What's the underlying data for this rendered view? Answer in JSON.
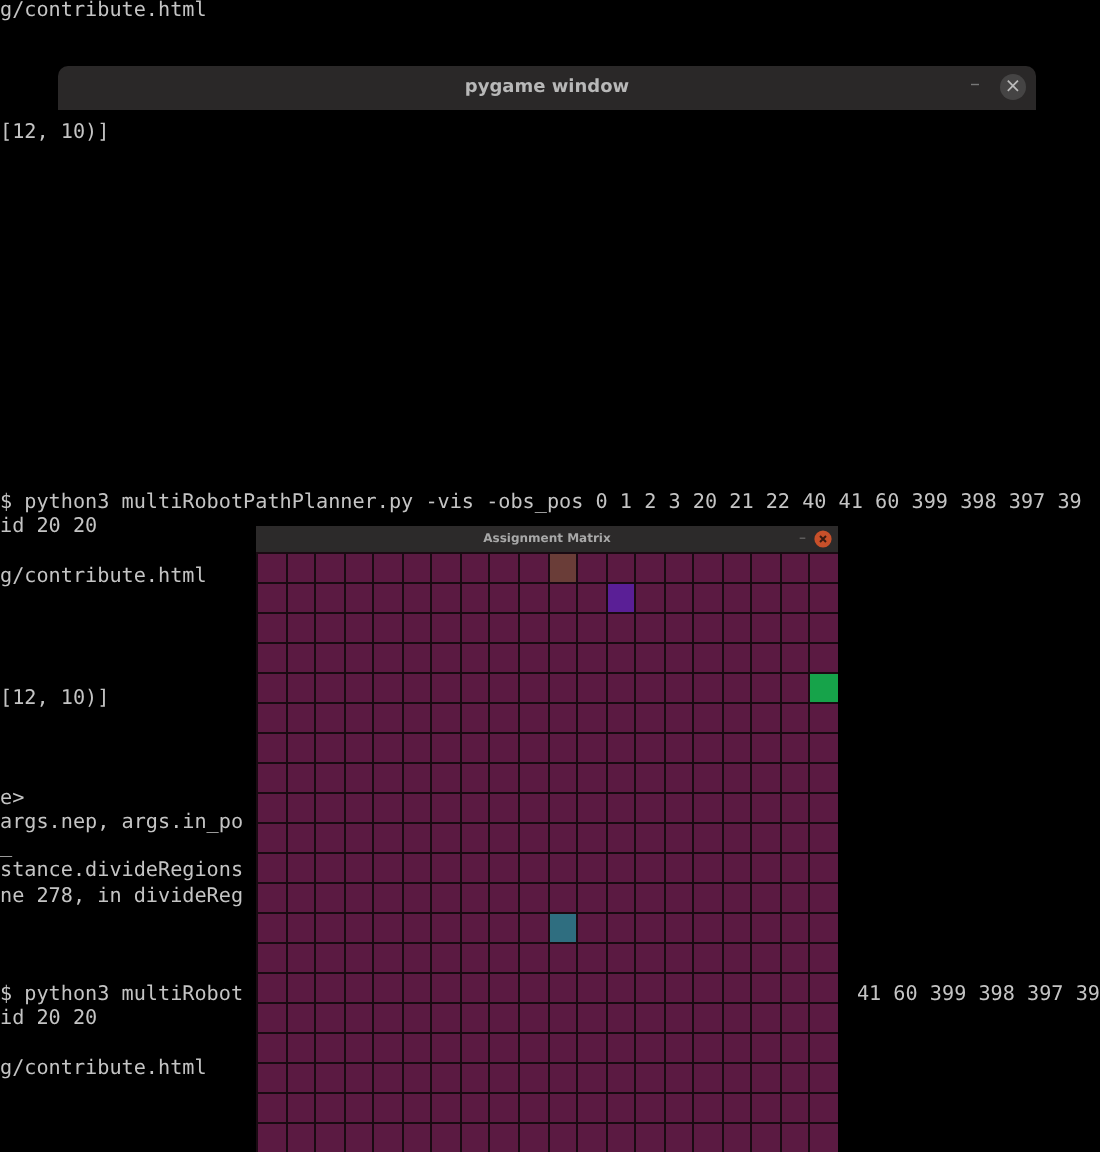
{
  "terminal": {
    "blocks": [
      [
        {
          "text": "g/contribute.html"
        }
      ],
      [
        {
          "text": "[12, 10)]"
        }
      ],
      [
        {
          "text": "$ python3 multiRobotPathPlanner.py -vis -obs_pos 0 1 2 3 20 21 22 40 41 60 399 398 397 39"
        },
        {
          "text": "id 20 20"
        }
      ],
      [
        {
          "text": "g/contribute.html"
        }
      ],
      [
        {
          "text": "[12, 10)]"
        }
      ],
      [
        {
          "text": "e>"
        },
        {
          "text": "args.nep, args.in_po"
        },
        {
          "text": "_"
        },
        {
          "text": "stance.divideRegions"
        },
        {
          "text": "ne 278, in divideReg"
        }
      ],
      [
        {
          "text": "$ python3 multiRobot",
          "right_text": "41 60 399 398 397 39"
        },
        {
          "text": "id 20 20"
        }
      ],
      [
        {
          "text": "g/contribute.html"
        }
      ]
    ]
  },
  "pygame_window": {
    "title": "pygame window",
    "minimize": "–",
    "close": "×"
  },
  "matrix_window": {
    "title": "Assignment Matrix",
    "minimize": "–",
    "grid_rows": [
      [
        {
          "color": "#5b1a42"
        },
        {
          "color": "#5b1a42"
        },
        {
          "color": "#5b1a42"
        },
        {
          "color": "#5b1a42"
        },
        {
          "color": "#5b1a42"
        },
        {
          "color": "#5b1a42"
        },
        {
          "color": "#5b1a42"
        },
        {
          "color": "#5b1a42"
        },
        {
          "color": "#5b1a42"
        },
        {
          "color": "#5b1a42"
        },
        {
          "color": "#6a3d38"
        },
        {
          "color": "#5b1a42"
        },
        {
          "color": "#5b1a42"
        },
        {
          "color": "#5b1a42"
        },
        {
          "color": "#5b1a42"
        },
        {
          "color": "#5b1a42"
        },
        {
          "color": "#5b1a42"
        },
        {
          "color": "#5b1a42"
        },
        {
          "color": "#5b1a42"
        },
        {
          "color": "#5b1a42"
        }
      ],
      [
        {
          "color": "#5b1a42"
        },
        {
          "color": "#5b1a42"
        },
        {
          "color": "#5b1a42"
        },
        {
          "color": "#5b1a42"
        },
        {
          "color": "#5b1a42"
        },
        {
          "color": "#5b1a42"
        },
        {
          "color": "#5b1a42"
        },
        {
          "color": "#5b1a42"
        },
        {
          "color": "#5b1a42"
        },
        {
          "color": "#5b1a42"
        },
        {
          "color": "#5b1a42"
        },
        {
          "color": "#5b1a42"
        },
        {
          "color": "#5a1f96"
        },
        {
          "color": "#5b1a42"
        },
        {
          "color": "#5b1a42"
        },
        {
          "color": "#5b1a42"
        },
        {
          "color": "#5b1a42"
        },
        {
          "color": "#5b1a42"
        },
        {
          "color": "#5b1a42"
        },
        {
          "color": "#5b1a42"
        }
      ],
      [
        {
          "color": "#5b1a42"
        },
        {
          "color": "#5b1a42"
        },
        {
          "color": "#5b1a42"
        },
        {
          "color": "#5b1a42"
        },
        {
          "color": "#5b1a42"
        },
        {
          "color": "#5b1a42"
        },
        {
          "color": "#5b1a42"
        },
        {
          "color": "#5b1a42"
        },
        {
          "color": "#5b1a42"
        },
        {
          "color": "#5b1a42"
        },
        {
          "color": "#5b1a42"
        },
        {
          "color": "#5b1a42"
        },
        {
          "color": "#5b1a42"
        },
        {
          "color": "#5b1a42"
        },
        {
          "color": "#5b1a42"
        },
        {
          "color": "#5b1a42"
        },
        {
          "color": "#5b1a42"
        },
        {
          "color": "#5b1a42"
        },
        {
          "color": "#5b1a42"
        },
        {
          "color": "#5b1a42"
        }
      ],
      [
        {
          "color": "#5b1a42"
        },
        {
          "color": "#5b1a42"
        },
        {
          "color": "#5b1a42"
        },
        {
          "color": "#5b1a42"
        },
        {
          "color": "#5b1a42"
        },
        {
          "color": "#5b1a42"
        },
        {
          "color": "#5b1a42"
        },
        {
          "color": "#5b1a42"
        },
        {
          "color": "#5b1a42"
        },
        {
          "color": "#5b1a42"
        },
        {
          "color": "#5b1a42"
        },
        {
          "color": "#5b1a42"
        },
        {
          "color": "#5b1a42"
        },
        {
          "color": "#5b1a42"
        },
        {
          "color": "#5b1a42"
        },
        {
          "color": "#5b1a42"
        },
        {
          "color": "#5b1a42"
        },
        {
          "color": "#5b1a42"
        },
        {
          "color": "#5b1a42"
        },
        {
          "color": "#5b1a42"
        }
      ],
      [
        {
          "color": "#5b1a42"
        },
        {
          "color": "#5b1a42"
        },
        {
          "color": "#5b1a42"
        },
        {
          "color": "#5b1a42"
        },
        {
          "color": "#5b1a42"
        },
        {
          "color": "#5b1a42"
        },
        {
          "color": "#5b1a42"
        },
        {
          "color": "#5b1a42"
        },
        {
          "color": "#5b1a42"
        },
        {
          "color": "#5b1a42"
        },
        {
          "color": "#5b1a42"
        },
        {
          "color": "#5b1a42"
        },
        {
          "color": "#5b1a42"
        },
        {
          "color": "#5b1a42"
        },
        {
          "color": "#5b1a42"
        },
        {
          "color": "#5b1a42"
        },
        {
          "color": "#5b1a42"
        },
        {
          "color": "#5b1a42"
        },
        {
          "color": "#5b1a42"
        },
        {
          "color": "#16a34a"
        }
      ],
      [
        {
          "color": "#5b1a42"
        },
        {
          "color": "#5b1a42"
        },
        {
          "color": "#5b1a42"
        },
        {
          "color": "#5b1a42"
        },
        {
          "color": "#5b1a42"
        },
        {
          "color": "#5b1a42"
        },
        {
          "color": "#5b1a42"
        },
        {
          "color": "#5b1a42"
        },
        {
          "color": "#5b1a42"
        },
        {
          "color": "#5b1a42"
        },
        {
          "color": "#5b1a42"
        },
        {
          "color": "#5b1a42"
        },
        {
          "color": "#5b1a42"
        },
        {
          "color": "#5b1a42"
        },
        {
          "color": "#5b1a42"
        },
        {
          "color": "#5b1a42"
        },
        {
          "color": "#5b1a42"
        },
        {
          "color": "#5b1a42"
        },
        {
          "color": "#5b1a42"
        },
        {
          "color": "#5b1a42"
        }
      ],
      [
        {
          "color": "#5b1a42"
        },
        {
          "color": "#5b1a42"
        },
        {
          "color": "#5b1a42"
        },
        {
          "color": "#5b1a42"
        },
        {
          "color": "#5b1a42"
        },
        {
          "color": "#5b1a42"
        },
        {
          "color": "#5b1a42"
        },
        {
          "color": "#5b1a42"
        },
        {
          "color": "#5b1a42"
        },
        {
          "color": "#5b1a42"
        },
        {
          "color": "#5b1a42"
        },
        {
          "color": "#5b1a42"
        },
        {
          "color": "#5b1a42"
        },
        {
          "color": "#5b1a42"
        },
        {
          "color": "#5b1a42"
        },
        {
          "color": "#5b1a42"
        },
        {
          "color": "#5b1a42"
        },
        {
          "color": "#5b1a42"
        },
        {
          "color": "#5b1a42"
        },
        {
          "color": "#5b1a42"
        }
      ],
      [
        {
          "color": "#5b1a42"
        },
        {
          "color": "#5b1a42"
        },
        {
          "color": "#5b1a42"
        },
        {
          "color": "#5b1a42"
        },
        {
          "color": "#5b1a42"
        },
        {
          "color": "#5b1a42"
        },
        {
          "color": "#5b1a42"
        },
        {
          "color": "#5b1a42"
        },
        {
          "color": "#5b1a42"
        },
        {
          "color": "#5b1a42"
        },
        {
          "color": "#5b1a42"
        },
        {
          "color": "#5b1a42"
        },
        {
          "color": "#5b1a42"
        },
        {
          "color": "#5b1a42"
        },
        {
          "color": "#5b1a42"
        },
        {
          "color": "#5b1a42"
        },
        {
          "color": "#5b1a42"
        },
        {
          "color": "#5b1a42"
        },
        {
          "color": "#5b1a42"
        },
        {
          "color": "#5b1a42"
        }
      ],
      [
        {
          "color": "#5b1a42"
        },
        {
          "color": "#5b1a42"
        },
        {
          "color": "#5b1a42"
        },
        {
          "color": "#5b1a42"
        },
        {
          "color": "#5b1a42"
        },
        {
          "color": "#5b1a42"
        },
        {
          "color": "#5b1a42"
        },
        {
          "color": "#5b1a42"
        },
        {
          "color": "#5b1a42"
        },
        {
          "color": "#5b1a42"
        },
        {
          "color": "#5b1a42"
        },
        {
          "color": "#5b1a42"
        },
        {
          "color": "#5b1a42"
        },
        {
          "color": "#5b1a42"
        },
        {
          "color": "#5b1a42"
        },
        {
          "color": "#5b1a42"
        },
        {
          "color": "#5b1a42"
        },
        {
          "color": "#5b1a42"
        },
        {
          "color": "#5b1a42"
        },
        {
          "color": "#5b1a42"
        }
      ],
      [
        {
          "color": "#5b1a42"
        },
        {
          "color": "#5b1a42"
        },
        {
          "color": "#5b1a42"
        },
        {
          "color": "#5b1a42"
        },
        {
          "color": "#5b1a42"
        },
        {
          "color": "#5b1a42"
        },
        {
          "color": "#5b1a42"
        },
        {
          "color": "#5b1a42"
        },
        {
          "color": "#5b1a42"
        },
        {
          "color": "#5b1a42"
        },
        {
          "color": "#5b1a42"
        },
        {
          "color": "#5b1a42"
        },
        {
          "color": "#5b1a42"
        },
        {
          "color": "#5b1a42"
        },
        {
          "color": "#5b1a42"
        },
        {
          "color": "#5b1a42"
        },
        {
          "color": "#5b1a42"
        },
        {
          "color": "#5b1a42"
        },
        {
          "color": "#5b1a42"
        },
        {
          "color": "#5b1a42"
        }
      ],
      [
        {
          "color": "#5b1a42"
        },
        {
          "color": "#5b1a42"
        },
        {
          "color": "#5b1a42"
        },
        {
          "color": "#5b1a42"
        },
        {
          "color": "#5b1a42"
        },
        {
          "color": "#5b1a42"
        },
        {
          "color": "#5b1a42"
        },
        {
          "color": "#5b1a42"
        },
        {
          "color": "#5b1a42"
        },
        {
          "color": "#5b1a42"
        },
        {
          "color": "#5b1a42"
        },
        {
          "color": "#5b1a42"
        },
        {
          "color": "#5b1a42"
        },
        {
          "color": "#5b1a42"
        },
        {
          "color": "#5b1a42"
        },
        {
          "color": "#5b1a42"
        },
        {
          "color": "#5b1a42"
        },
        {
          "color": "#5b1a42"
        },
        {
          "color": "#5b1a42"
        },
        {
          "color": "#5b1a42"
        }
      ],
      [
        {
          "color": "#5b1a42"
        },
        {
          "color": "#5b1a42"
        },
        {
          "color": "#5b1a42"
        },
        {
          "color": "#5b1a42"
        },
        {
          "color": "#5b1a42"
        },
        {
          "color": "#5b1a42"
        },
        {
          "color": "#5b1a42"
        },
        {
          "color": "#5b1a42"
        },
        {
          "color": "#5b1a42"
        },
        {
          "color": "#5b1a42"
        },
        {
          "color": "#5b1a42"
        },
        {
          "color": "#5b1a42"
        },
        {
          "color": "#5b1a42"
        },
        {
          "color": "#5b1a42"
        },
        {
          "color": "#5b1a42"
        },
        {
          "color": "#5b1a42"
        },
        {
          "color": "#5b1a42"
        },
        {
          "color": "#5b1a42"
        },
        {
          "color": "#5b1a42"
        },
        {
          "color": "#5b1a42"
        }
      ],
      [
        {
          "color": "#5b1a42"
        },
        {
          "color": "#5b1a42"
        },
        {
          "color": "#5b1a42"
        },
        {
          "color": "#5b1a42"
        },
        {
          "color": "#5b1a42"
        },
        {
          "color": "#5b1a42"
        },
        {
          "color": "#5b1a42"
        },
        {
          "color": "#5b1a42"
        },
        {
          "color": "#5b1a42"
        },
        {
          "color": "#5b1a42"
        },
        {
          "color": "#2f6e80"
        },
        {
          "color": "#5b1a42"
        },
        {
          "color": "#5b1a42"
        },
        {
          "color": "#5b1a42"
        },
        {
          "color": "#5b1a42"
        },
        {
          "color": "#5b1a42"
        },
        {
          "color": "#5b1a42"
        },
        {
          "color": "#5b1a42"
        },
        {
          "color": "#5b1a42"
        },
        {
          "color": "#5b1a42"
        }
      ],
      [
        {
          "color": "#5b1a42"
        },
        {
          "color": "#5b1a42"
        },
        {
          "color": "#5b1a42"
        },
        {
          "color": "#5b1a42"
        },
        {
          "color": "#5b1a42"
        },
        {
          "color": "#5b1a42"
        },
        {
          "color": "#5b1a42"
        },
        {
          "color": "#5b1a42"
        },
        {
          "color": "#5b1a42"
        },
        {
          "color": "#5b1a42"
        },
        {
          "color": "#5b1a42"
        },
        {
          "color": "#5b1a42"
        },
        {
          "color": "#5b1a42"
        },
        {
          "color": "#5b1a42"
        },
        {
          "color": "#5b1a42"
        },
        {
          "color": "#5b1a42"
        },
        {
          "color": "#5b1a42"
        },
        {
          "color": "#5b1a42"
        },
        {
          "color": "#5b1a42"
        },
        {
          "color": "#5b1a42"
        }
      ],
      [
        {
          "color": "#5b1a42"
        },
        {
          "color": "#5b1a42"
        },
        {
          "color": "#5b1a42"
        },
        {
          "color": "#5b1a42"
        },
        {
          "color": "#5b1a42"
        },
        {
          "color": "#5b1a42"
        },
        {
          "color": "#5b1a42"
        },
        {
          "color": "#5b1a42"
        },
        {
          "color": "#5b1a42"
        },
        {
          "color": "#5b1a42"
        },
        {
          "color": "#5b1a42"
        },
        {
          "color": "#5b1a42"
        },
        {
          "color": "#5b1a42"
        },
        {
          "color": "#5b1a42"
        },
        {
          "color": "#5b1a42"
        },
        {
          "color": "#5b1a42"
        },
        {
          "color": "#5b1a42"
        },
        {
          "color": "#5b1a42"
        },
        {
          "color": "#5b1a42"
        },
        {
          "color": "#5b1a42"
        }
      ],
      [
        {
          "color": "#5b1a42"
        },
        {
          "color": "#5b1a42"
        },
        {
          "color": "#5b1a42"
        },
        {
          "color": "#5b1a42"
        },
        {
          "color": "#5b1a42"
        },
        {
          "color": "#5b1a42"
        },
        {
          "color": "#5b1a42"
        },
        {
          "color": "#5b1a42"
        },
        {
          "color": "#5b1a42"
        },
        {
          "color": "#5b1a42"
        },
        {
          "color": "#5b1a42"
        },
        {
          "color": "#5b1a42"
        },
        {
          "color": "#5b1a42"
        },
        {
          "color": "#5b1a42"
        },
        {
          "color": "#5b1a42"
        },
        {
          "color": "#5b1a42"
        },
        {
          "color": "#5b1a42"
        },
        {
          "color": "#5b1a42"
        },
        {
          "color": "#5b1a42"
        },
        {
          "color": "#5b1a42"
        }
      ],
      [
        {
          "color": "#5b1a42"
        },
        {
          "color": "#5b1a42"
        },
        {
          "color": "#5b1a42"
        },
        {
          "color": "#5b1a42"
        },
        {
          "color": "#5b1a42"
        },
        {
          "color": "#5b1a42"
        },
        {
          "color": "#5b1a42"
        },
        {
          "color": "#5b1a42"
        },
        {
          "color": "#5b1a42"
        },
        {
          "color": "#5b1a42"
        },
        {
          "color": "#5b1a42"
        },
        {
          "color": "#5b1a42"
        },
        {
          "color": "#5b1a42"
        },
        {
          "color": "#5b1a42"
        },
        {
          "color": "#5b1a42"
        },
        {
          "color": "#5b1a42"
        },
        {
          "color": "#5b1a42"
        },
        {
          "color": "#5b1a42"
        },
        {
          "color": "#5b1a42"
        },
        {
          "color": "#5b1a42"
        }
      ],
      [
        {
          "color": "#5b1a42"
        },
        {
          "color": "#5b1a42"
        },
        {
          "color": "#5b1a42"
        },
        {
          "color": "#5b1a42"
        },
        {
          "color": "#5b1a42"
        },
        {
          "color": "#5b1a42"
        },
        {
          "color": "#5b1a42"
        },
        {
          "color": "#5b1a42"
        },
        {
          "color": "#5b1a42"
        },
        {
          "color": "#5b1a42"
        },
        {
          "color": "#5b1a42"
        },
        {
          "color": "#5b1a42"
        },
        {
          "color": "#5b1a42"
        },
        {
          "color": "#5b1a42"
        },
        {
          "color": "#5b1a42"
        },
        {
          "color": "#5b1a42"
        },
        {
          "color": "#5b1a42"
        },
        {
          "color": "#5b1a42"
        },
        {
          "color": "#5b1a42"
        },
        {
          "color": "#5b1a42"
        }
      ],
      [
        {
          "color": "#5b1a42"
        },
        {
          "color": "#5b1a42"
        },
        {
          "color": "#5b1a42"
        },
        {
          "color": "#5b1a42"
        },
        {
          "color": "#5b1a42"
        },
        {
          "color": "#5b1a42"
        },
        {
          "color": "#5b1a42"
        },
        {
          "color": "#5b1a42"
        },
        {
          "color": "#5b1a42"
        },
        {
          "color": "#5b1a42"
        },
        {
          "color": "#5b1a42"
        },
        {
          "color": "#5b1a42"
        },
        {
          "color": "#5b1a42"
        },
        {
          "color": "#5b1a42"
        },
        {
          "color": "#5b1a42"
        },
        {
          "color": "#5b1a42"
        },
        {
          "color": "#5b1a42"
        },
        {
          "color": "#5b1a42"
        },
        {
          "color": "#5b1a42"
        },
        {
          "color": "#5b1a42"
        }
      ],
      [
        {
          "color": "#5b1a42"
        },
        {
          "color": "#5b1a42"
        },
        {
          "color": "#5b1a42"
        },
        {
          "color": "#5b1a42"
        },
        {
          "color": "#5b1a42"
        },
        {
          "color": "#5b1a42"
        },
        {
          "color": "#5b1a42"
        },
        {
          "color": "#5b1a42"
        },
        {
          "color": "#5b1a42"
        },
        {
          "color": "#5b1a42"
        },
        {
          "color": "#5b1a42"
        },
        {
          "color": "#5b1a42"
        },
        {
          "color": "#5b1a42"
        },
        {
          "color": "#5b1a42"
        },
        {
          "color": "#5b1a42"
        },
        {
          "color": "#5b1a42"
        },
        {
          "color": "#5b1a42"
        },
        {
          "color": "#5b1a42"
        },
        {
          "color": "#5b1a42"
        },
        {
          "color": "#5b1a42"
        }
      ]
    ]
  }
}
